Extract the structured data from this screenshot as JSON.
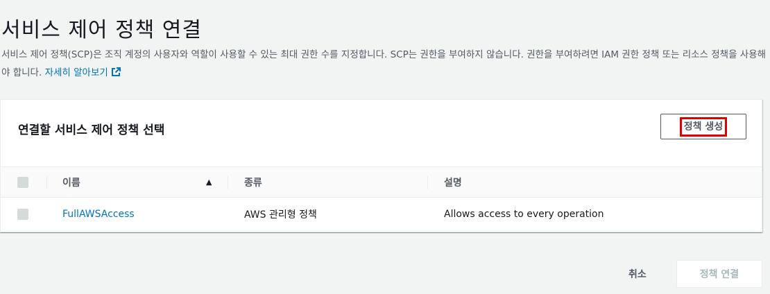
{
  "header": {
    "title": "서비스 제어 정책 연결",
    "description": "서비스 제어 정책(SCP)은 조직 계정의 사용자와 역할이 사용할 수 있는 최대 권한 수를 지정합니다. SCP는 권한을 부여하지 않습니다. 권한을 부여하려면 IAM 권한 정책 또는 리소스 정책을 사용해야 합니다.",
    "learn_more": "자세히 알아보기",
    "learn_more_icon": "external-link-icon"
  },
  "panel": {
    "title": "연결할 서비스 제어 정책 선택",
    "create_button": "정책 생성"
  },
  "table": {
    "columns": {
      "name": "이름",
      "type": "종류",
      "description": "설명"
    },
    "sort_icon": "▲",
    "rows": [
      {
        "name": "FullAWSAccess",
        "type": "AWS 관리형 정책",
        "description": "Allows access to every operation"
      }
    ]
  },
  "footer": {
    "cancel": "취소",
    "attach": "정책 연결"
  },
  "colors": {
    "link": "#0073bb",
    "highlight_box": "#e00000",
    "disabled_text": "#aab7b8"
  }
}
